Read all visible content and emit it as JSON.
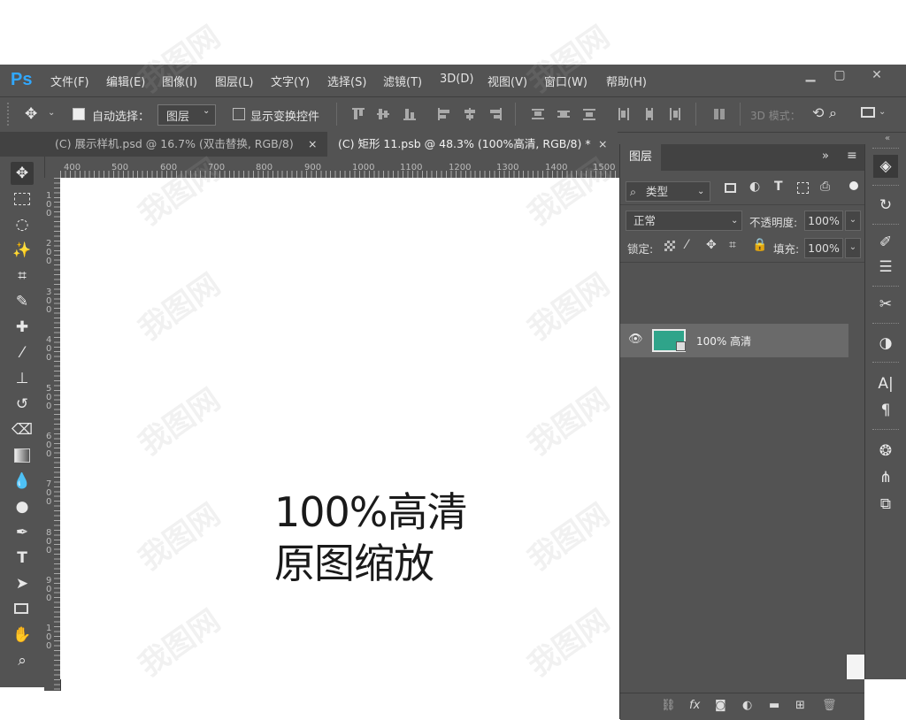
{
  "app": {
    "logo": "Ps"
  },
  "menu": [
    "文件(F)",
    "编辑(E)",
    "图像(I)",
    "图层(L)",
    "文字(Y)",
    "选择(S)",
    "滤镜(T)",
    "3D(D)",
    "视图(V)",
    "窗口(W)",
    "帮助(H)"
  ],
  "options": {
    "auto_select_label": "自动选择：",
    "auto_select_value": "图层",
    "show_transform_label": "显示变换控件",
    "mode_3d_label": "3D 模式："
  },
  "tabs": [
    {
      "label": "(C) 展示样机.psd @ 16.7% (双击替换, RGB/8)",
      "close": "×"
    },
    {
      "label": "(C) 矩形 11.psb @ 48.3% (100%高清, RGB/8) *",
      "close": "×"
    }
  ],
  "rulers": {
    "top": [
      "400",
      "500",
      "600",
      "700",
      "800",
      "900",
      "1000",
      "1100",
      "1200",
      "1300",
      "1400",
      "1500"
    ],
    "left": [
      "100",
      "200",
      "300",
      "400",
      "500",
      "600",
      "700",
      "800",
      "900",
      "100"
    ]
  },
  "canvas": {
    "line1": "100%高清",
    "line2": "原图缩放"
  },
  "layers_panel": {
    "title": "图层",
    "filter_label": "类型",
    "blend_mode": "正常",
    "opacity_label": "不透明度:",
    "opacity_value": "100%",
    "lock_label": "锁定:",
    "fill_label": "填充:",
    "fill_value": "100%",
    "layer_name": "100% 高清",
    "layer_color": "#2fa48a"
  },
  "watermark": "我图网"
}
